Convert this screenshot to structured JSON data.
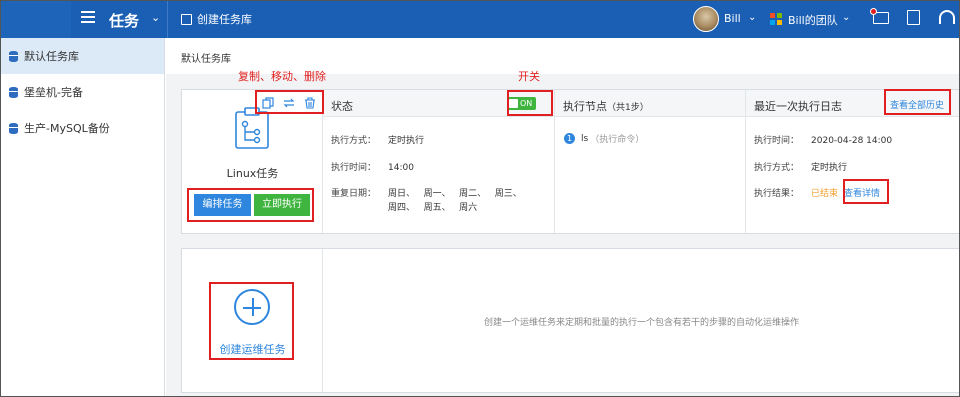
{
  "header": {
    "app_title": "任务",
    "create_library": "创建任务库",
    "user_name": "Bill",
    "team_name": "Bill的团队"
  },
  "sidebar": {
    "items": [
      {
        "label": "默认任务库",
        "active": true
      },
      {
        "label": "堡垒机-完备",
        "active": false
      },
      {
        "label": "生产-MySQL备份",
        "active": false
      }
    ]
  },
  "breadcrumb": "默认任务库",
  "annotations": {
    "copy_move_delete": "复制、移动、删除",
    "switch": "开关"
  },
  "task": {
    "name": "Linux任务",
    "edit_button": "编排任务",
    "run_button": "立即执行",
    "status_header": "状态",
    "toggle_label": "ON",
    "exec_mode_label": "执行方式：",
    "exec_mode_value": "定时执行",
    "exec_time_label": "执行时间：",
    "exec_time_value": "14:00",
    "repeat_label": "重复日期：",
    "repeat_line1": "周日、   周一、   周二、   周三、",
    "repeat_line2": "周四、   周五、   周六",
    "nodes_header": "执行节点",
    "nodes_count": "（共1步）",
    "step_number": "1",
    "step_name": "ls",
    "step_type": "（执行命令）",
    "log_header": "最近一次执行日志",
    "view_all_history": "查看全部历史",
    "log_time_label": "执行时间：",
    "log_time_value": "2020-04-28 14:00",
    "log_mode_label": "执行方式：",
    "log_mode_value": "定时执行",
    "log_result_label": "执行结果：",
    "log_result_value": "已结束",
    "view_details": "查看详情"
  },
  "create_card": {
    "label": "创建运维任务",
    "hint": "创建一个运维任务来定期和批量的执行一个包含有若干的步骤的自动化运维操作"
  },
  "colors": {
    "topbar": "#1a5fb4",
    "accent_blue": "#2e86de",
    "green": "#3fb53f",
    "annotation_red": "#e02020",
    "result_orange": "#f0a030"
  }
}
